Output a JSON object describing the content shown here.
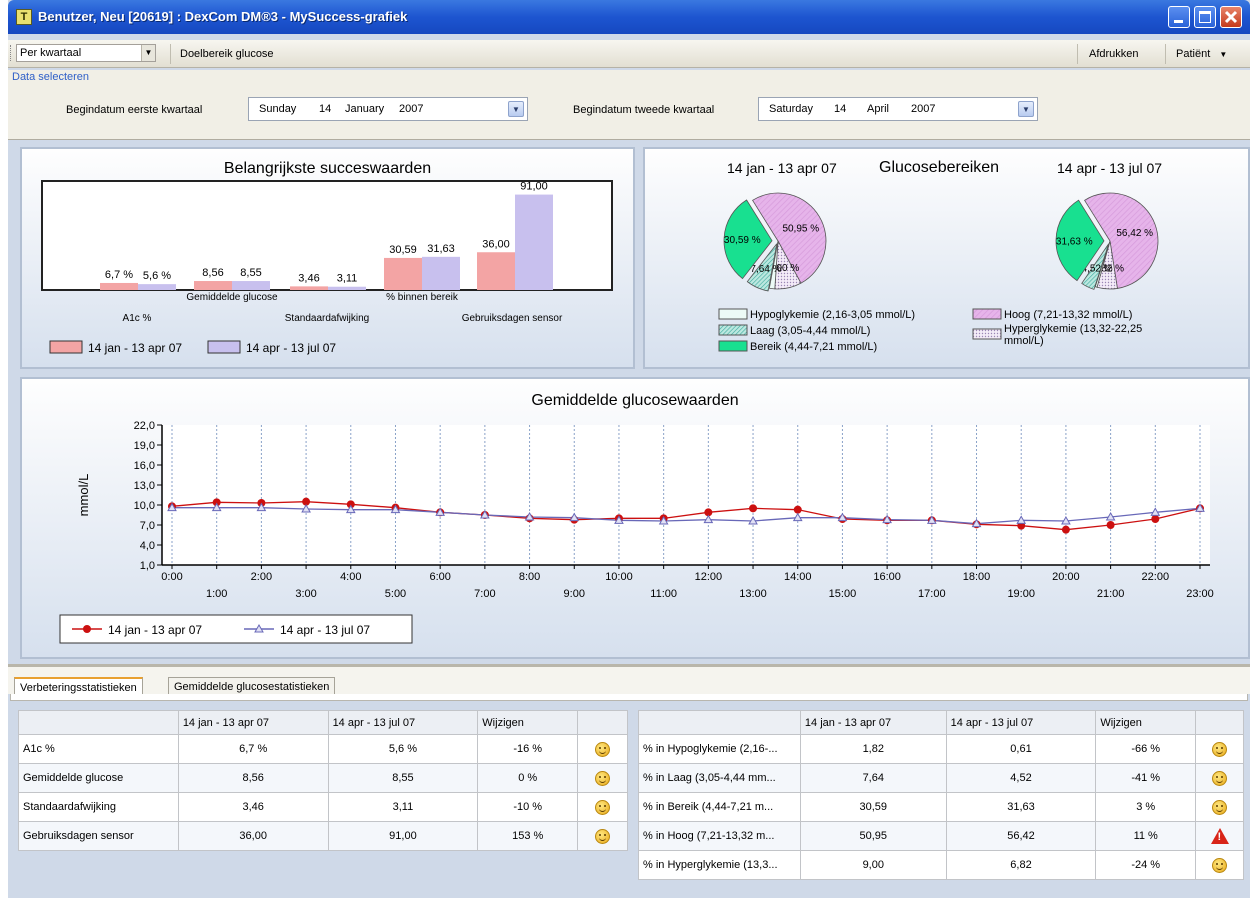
{
  "window": {
    "title": "Benutzer, Neu [20619] : DexCom DM®3 - MySuccess-grafiek",
    "app_icon": "T"
  },
  "toolbar": {
    "period_select": "Per kwartaal",
    "target_range_label": "Doelbereik glucose",
    "print_label": "Afdrukken",
    "patient_label": "Patiënt"
  },
  "data_select": {
    "title": "Data selecteren",
    "q1_label": "Begindatum eerste kwartaal",
    "q1_date": {
      "weekday": "Sunday",
      "day": "14",
      "month": "January",
      "year": "2007"
    },
    "q2_label": "Begindatum tweede kwartaal",
    "q2_date": {
      "weekday": "Saturday",
      "day": "14",
      "month": "April",
      "year": "2007"
    }
  },
  "colors": {
    "period1": "#f3a4a4",
    "period2": "#c8c0ee",
    "line1": "#cc1010",
    "line2": "#6868b8",
    "hoog": "#e6b4ea",
    "bereik": "#18e090",
    "laag": "#60c4b8",
    "hypo": "#ecfaf6"
  },
  "success_panel": {
    "title": "Belangrijkste succeswaarden",
    "legend": [
      "14 jan - 13 apr 07",
      "14 apr - 13 jul 07"
    ]
  },
  "ranges_panel": {
    "title": "Glucosebereiken",
    "period1_label": "14 jan - 13 apr 07",
    "period2_label": "14 apr - 13 jul 07",
    "legend": {
      "hypo": "Hypoglykemie (2,16-3,05 mmol/L)",
      "laag": "Laag (3,05-4,44 mmol/L)",
      "bereik": "Bereik (4,44-7,21 mmol/L)",
      "hoog": "Hoog (7,21-13,32 mmol/L)",
      "hyper_line1": "Hyperglykemie (13,32-22,25",
      "hyper_line2": "mmol/L)"
    }
  },
  "avg_panel": {
    "title": "Gemiddelde glucosewaarden",
    "legend": [
      "14 jan - 13 apr 07",
      "14 apr - 13 jul 07"
    ]
  },
  "chart_data": [
    {
      "type": "bar",
      "title": "Belangrijkste succeswaarden",
      "categories": [
        "A1c %",
        "Gemiddelde glucose",
        "Standaardafwijking",
        "% binnen bereik",
        "Gebruiksdagen sensor"
      ],
      "series": [
        {
          "name": "14 jan - 13 apr 07",
          "values": [
            6.7,
            8.56,
            3.46,
            30.59,
            36.0
          ],
          "labels": [
            "6,7 %",
            "8,56",
            "3,46",
            "30,59",
            "36,00"
          ]
        },
        {
          "name": "14 apr - 13 jul 07",
          "values": [
            5.6,
            8.55,
            3.11,
            31.63,
            91.0
          ],
          "labels": [
            "5,6 %",
            "8,55",
            "3,11",
            "31,63",
            "91,00"
          ]
        }
      ],
      "ylim": [
        0,
        100
      ]
    },
    {
      "type": "pie",
      "title": "Glucosebereiken",
      "subtitle": "14 jan - 13 apr 07",
      "slices": [
        {
          "name": "Hoog (7,21-13,32 mmol/L)",
          "key": "hoog",
          "value": 50.95,
          "label": "50,95 %"
        },
        {
          "name": "Hyperglykemie (13,32-22,25 mmol/L)",
          "key": "hyper",
          "value": 9.0,
          "label": "9,00 %"
        },
        {
          "name": "Hypoglykemie (2,16-3,05 mmol/L)",
          "key": "hypo",
          "value": 1.82,
          "label": ""
        },
        {
          "name": "Laag (3,05-4,44 mmol/L)",
          "key": "laag",
          "value": 7.64,
          "label": "7,64 %"
        },
        {
          "name": "Bereik (4,44-7,21 mmol/L)",
          "key": "bereik",
          "value": 30.59,
          "label": "30,59 %"
        }
      ]
    },
    {
      "type": "pie",
      "title": "Glucosebereiken",
      "subtitle": "14 apr - 13 jul 07",
      "slices": [
        {
          "name": "Hoog (7,21-13,32 mmol/L)",
          "key": "hoog",
          "value": 56.42,
          "label": "56,42 %"
        },
        {
          "name": "Hyperglykemie (13,32-22,25 mmol/L)",
          "key": "hyper",
          "value": 6.82,
          "label": "6,82 %"
        },
        {
          "name": "Hypoglykemie (2,16-3,05 mmol/L)",
          "key": "hypo",
          "value": 0.61,
          "label": ""
        },
        {
          "name": "Laag (3,05-4,44 mmol/L)",
          "key": "laag",
          "value": 4.52,
          "label": "4,52 %"
        },
        {
          "name": "Bereik (4,44-7,21 mmol/L)",
          "key": "bereik",
          "value": 31.63,
          "label": "31,63 %"
        }
      ]
    },
    {
      "type": "line",
      "title": "Gemiddelde glucosewaarden",
      "ylabel": "mmol/L",
      "x": [
        "0:00",
        "1:00",
        "2:00",
        "3:00",
        "4:00",
        "5:00",
        "6:00",
        "7:00",
        "8:00",
        "9:00",
        "10:00",
        "11:00",
        "12:00",
        "13:00",
        "14:00",
        "15:00",
        "16:00",
        "17:00",
        "18:00",
        "19:00",
        "20:00",
        "21:00",
        "22:00",
        "23:00"
      ],
      "y_ticks": [
        "1,0",
        "4,0",
        "7,0",
        "10,0",
        "13,0",
        "16,0",
        "19,0",
        "22,0"
      ],
      "ylim": [
        1.0,
        22.0
      ],
      "grid": true,
      "series": [
        {
          "name": "14 jan - 13 apr 07",
          "values": [
            9.8,
            10.4,
            10.3,
            10.5,
            10.1,
            9.6,
            8.9,
            8.5,
            8.0,
            7.8,
            8.0,
            8.0,
            8.9,
            9.5,
            9.3,
            7.9,
            7.7,
            7.7,
            7.1,
            6.9,
            6.3,
            7.0,
            7.9,
            9.5
          ]
        },
        {
          "name": "14 apr - 13 jul 07",
          "values": [
            9.6,
            9.6,
            9.6,
            9.4,
            9.3,
            9.3,
            8.9,
            8.5,
            8.2,
            8.1,
            7.7,
            7.6,
            7.8,
            7.6,
            8.1,
            8.1,
            7.8,
            7.7,
            7.2,
            7.7,
            7.6,
            8.2,
            8.9,
            9.5
          ]
        }
      ]
    }
  ],
  "tabs": [
    "Verbeteringsstatistieken",
    "Gemiddelde glucosestatistieken"
  ],
  "table_left": {
    "headers": [
      "",
      "14 jan - 13 apr 07",
      "14 apr - 13 jul 07",
      "Wijzigen",
      ""
    ],
    "rows": [
      {
        "label": "A1c %",
        "p1": "6,7 %",
        "p2": "5,6 %",
        "change": "-16 %",
        "icon": "smiley-icon"
      },
      {
        "label": "Gemiddelde glucose",
        "p1": "8,56",
        "p2": "8,55",
        "change": "0 %",
        "icon": "smiley-icon"
      },
      {
        "label": "Standaardafwijking",
        "p1": "3,46",
        "p2": "3,11",
        "change": "-10 %",
        "icon": "smiley-icon"
      },
      {
        "label": "Gebruiksdagen sensor",
        "p1": "36,00",
        "p2": "91,00",
        "change": "153 %",
        "icon": "smiley-icon"
      }
    ]
  },
  "table_right": {
    "headers": [
      "",
      "14 jan - 13 apr 07",
      "14 apr - 13 jul 07",
      "Wijzigen",
      ""
    ],
    "rows": [
      {
        "label": "% in Hypoglykemie (2,16-...",
        "p1": "1,82",
        "p2": "0,61",
        "change": "-66 %",
        "icon": "smiley-icon"
      },
      {
        "label": "% in Laag (3,05-4,44 mm...",
        "p1": "7,64",
        "p2": "4,52",
        "change": "-41 %",
        "icon": "smiley-icon"
      },
      {
        "label": "% in Bereik (4,44-7,21 m...",
        "p1": "30,59",
        "p2": "31,63",
        "change": "3 %",
        "icon": "smiley-icon"
      },
      {
        "label": "% in Hoog (7,21-13,32 m...",
        "p1": "50,95",
        "p2": "56,42",
        "change": "11 %",
        "icon": "warning-icon"
      },
      {
        "label": "% in Hyperglykemie (13,3...",
        "p1": "9,00",
        "p2": "6,82",
        "change": "-24 %",
        "icon": "smiley-icon"
      }
    ]
  }
}
